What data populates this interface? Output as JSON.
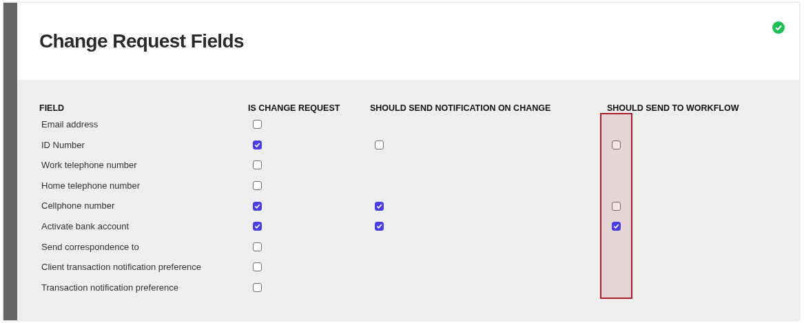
{
  "header": {
    "title": "Change Request Fields",
    "saved": true
  },
  "table": {
    "columns": [
      {
        "label": "FIELD",
        "highlighted": false
      },
      {
        "label": "IS CHANGE REQUEST",
        "highlighted": false
      },
      {
        "label": "SHOULD SEND NOTIFICATION ON CHANGE",
        "highlighted": false
      },
      {
        "label": "SHOULD SEND TO WORKFLOW",
        "highlighted": true
      }
    ],
    "rows": [
      {
        "field": "Email address",
        "change_request": {
          "checked": false
        }
      },
      {
        "field": "ID Number",
        "change_request": {
          "checked": true
        },
        "notification": {
          "checked": false
        },
        "workflow": {
          "checked": false
        }
      },
      {
        "field": "Work telephone number",
        "change_request": {
          "checked": false
        }
      },
      {
        "field": "Home telephone number",
        "change_request": {
          "checked": false
        }
      },
      {
        "field": "Cellphone number",
        "change_request": {
          "checked": true
        },
        "notification": {
          "checked": true
        },
        "workflow": {
          "checked": false
        }
      },
      {
        "field": "Activate bank account",
        "change_request": {
          "checked": true
        },
        "notification": {
          "checked": true
        },
        "workflow": {
          "checked": true
        }
      },
      {
        "field": "Send correspondence to",
        "change_request": {
          "checked": false
        }
      },
      {
        "field": "Client transaction notification preference",
        "change_request": {
          "checked": false
        }
      },
      {
        "field": "Transaction notification preference",
        "change_request": {
          "checked": false
        }
      }
    ]
  }
}
